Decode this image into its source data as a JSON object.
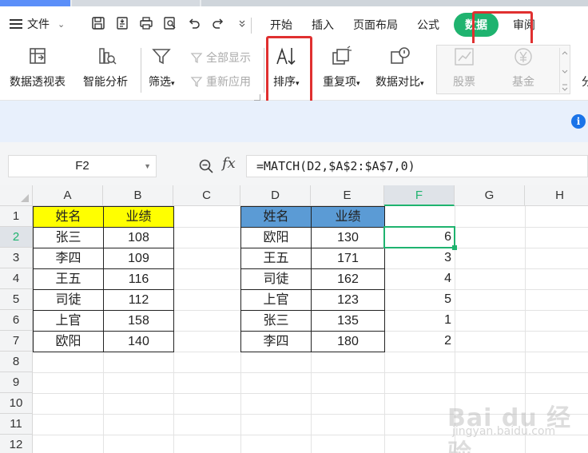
{
  "menu": {
    "file_label": "文件",
    "tabs": [
      "开始",
      "插入",
      "页面布局",
      "公式",
      "数据",
      "审阅"
    ],
    "active_tab": "数据"
  },
  "ribbon": {
    "pivot": "数据透视表",
    "smart": "智能分析",
    "filter": "筛选",
    "show_all": "全部显示",
    "reapply": "重新应用",
    "sort": "排序",
    "duplicate": "重复项",
    "compare": "数据对比",
    "stock": "股票",
    "fund": "基金",
    "more": "分"
  },
  "namebox": "F2",
  "formula": "=MATCH(D2,$A$2:$A$7,0)",
  "columns": [
    "A",
    "B",
    "C",
    "D",
    "E",
    "F",
    "G",
    "H"
  ],
  "selected_column": "F",
  "rows": [
    "1",
    "2",
    "3",
    "4",
    "5",
    "6",
    "7",
    "8",
    "9",
    "10",
    "11",
    "12"
  ],
  "selected_row": "2",
  "table1": {
    "headers": [
      "姓名",
      "业绩"
    ],
    "rows": [
      [
        "张三",
        "108"
      ],
      [
        "李四",
        "109"
      ],
      [
        "王五",
        "116"
      ],
      [
        "司徒",
        "112"
      ],
      [
        "上官",
        "158"
      ],
      [
        "欧阳",
        "140"
      ]
    ]
  },
  "table2": {
    "headers": [
      "姓名",
      "业绩"
    ],
    "rows": [
      [
        "欧阳",
        "130",
        "6"
      ],
      [
        "王五",
        "171",
        "3"
      ],
      [
        "司徒",
        "162",
        "4"
      ],
      [
        "上官",
        "123",
        "5"
      ],
      [
        "张三",
        "135",
        "1"
      ],
      [
        "李四",
        "180",
        "2"
      ]
    ]
  },
  "watermark": "Bai du 经验",
  "watermark_sub": "jingyan.baidu.com"
}
